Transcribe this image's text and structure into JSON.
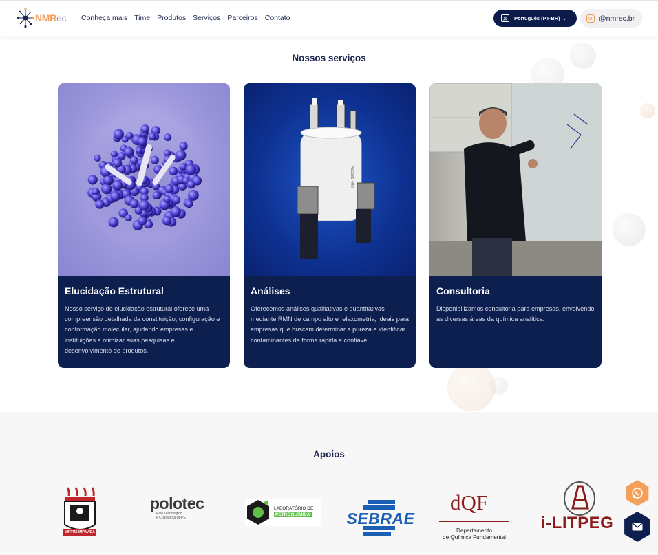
{
  "header": {
    "logo_main": "NMR",
    "logo_suffix": "ec",
    "nav": [
      "Conheça mais",
      "Time",
      "Produtos",
      "Serviços",
      "Parceiros",
      "Contato"
    ],
    "language_label": "Português (PT-BR)",
    "instagram_handle": "@nmrec.br"
  },
  "services": {
    "title": "Nossos serviços",
    "cards": [
      {
        "title": "Elucidação Estrutural",
        "text": "Nosso serviço de elucidação estrutural oferece uma compreensão detalhada da constituição, configuração e conformação molecular, ajudando empresas e instituições a otimizar suas pesquisas e desenvolvimento de produtos."
      },
      {
        "title": "Análises",
        "text": "Oferecemos análises qualitativas e quantitativas mediante RMN de campo alto e relaxometria, ideais para empresas que buscam determinar a pureza e identificar contaminantes de forma rápida e confiável."
      },
      {
        "title": "Consultoria",
        "text": "Disponibilizamos consultoria para empresas, envolvendo as diversas áreas da química analítica."
      }
    ]
  },
  "supports": {
    "title": "Apoios",
    "ufpe_motto": "VIRTUS IMPAVIDA",
    "polotec_name": "polotec",
    "polotec_sub1": "Polo Tecnológico",
    "polotec_sub2": "e Criativo da UFPE",
    "petro_line1": "LABORATÓRIO DE",
    "petro_line2": "PETROQUÍMICA",
    "sebrae": "SEBRAE",
    "dqf_name": "dQF",
    "dqf_line1": "Departamento",
    "dqf_line2": "de Química Fundamental",
    "litpeg": "i-LITPEG"
  },
  "colors": {
    "navy": "#0d1f4f",
    "orange": "#f39a4e",
    "sebrae_blue": "#1a5fb4",
    "dqf_red": "#8b1a1a"
  },
  "icons": {
    "whatsapp": "whatsapp-icon",
    "mail": "mail-icon",
    "translate": "translate-icon",
    "instagram": "instagram-icon"
  }
}
